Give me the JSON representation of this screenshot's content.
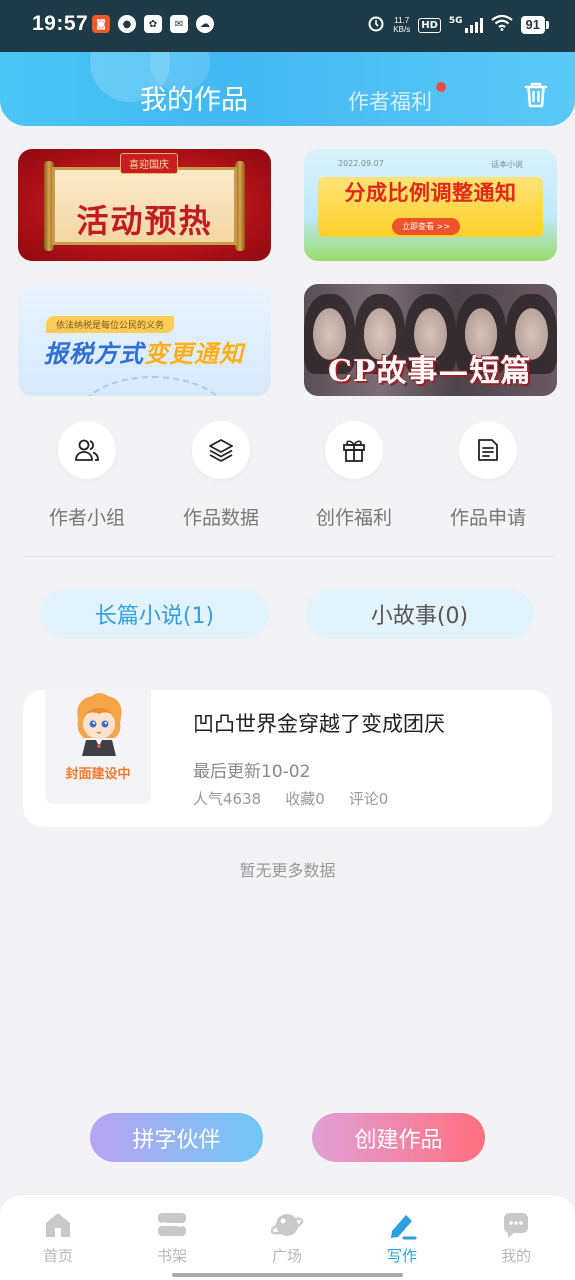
{
  "status_bar": {
    "time": "19:57",
    "net_speed_value": "11.7",
    "net_speed_unit": "KB/s",
    "hd_label": "HD",
    "network_label": "5G",
    "battery": "91"
  },
  "header": {
    "tab_works": "我的作品",
    "tab_benefits": "作者福利",
    "accent": "#43b8f2"
  },
  "banners": [
    {
      "tag": "喜迎国庆",
      "title": "活动预热"
    },
    {
      "date": "2022.09.07",
      "type": "话本小说",
      "title": "分成比例调整通知",
      "button": "立即查看 >>"
    },
    {
      "subtitle": "依法纳税是每位公民的义务",
      "title_part1": "报税方式",
      "title_part2": "变更通知"
    },
    {
      "title": "CP故事—短篇征文"
    }
  ],
  "quick_actions": [
    {
      "label": "作者小组",
      "icon": "users-icon"
    },
    {
      "label": "作品数据",
      "icon": "layers-icon"
    },
    {
      "label": "创作福利",
      "icon": "gift-icon"
    },
    {
      "label": "作品申请",
      "icon": "document-icon"
    }
  ],
  "segments": {
    "long": "长篇小说(1)",
    "short": "小故事(0)"
  },
  "work": {
    "cover_caption": "封面建设中",
    "title": "凹凸世界金穿越了变成团厌",
    "updated": "最后更新10-02",
    "popularity": "人气4638",
    "favorites": "收藏0",
    "comments": "评论0"
  },
  "no_more": "暂无更多数据",
  "actions": {
    "partner": "拼字伙伴",
    "create": "创建作品"
  },
  "bottom_nav": [
    {
      "label": "首页",
      "icon": "home-icon"
    },
    {
      "label": "书架",
      "icon": "bookshelf-icon"
    },
    {
      "label": "广场",
      "icon": "planet-icon"
    },
    {
      "label": "写作",
      "icon": "pen-icon",
      "active": true
    },
    {
      "label": "我的",
      "icon": "chat-icon"
    }
  ]
}
